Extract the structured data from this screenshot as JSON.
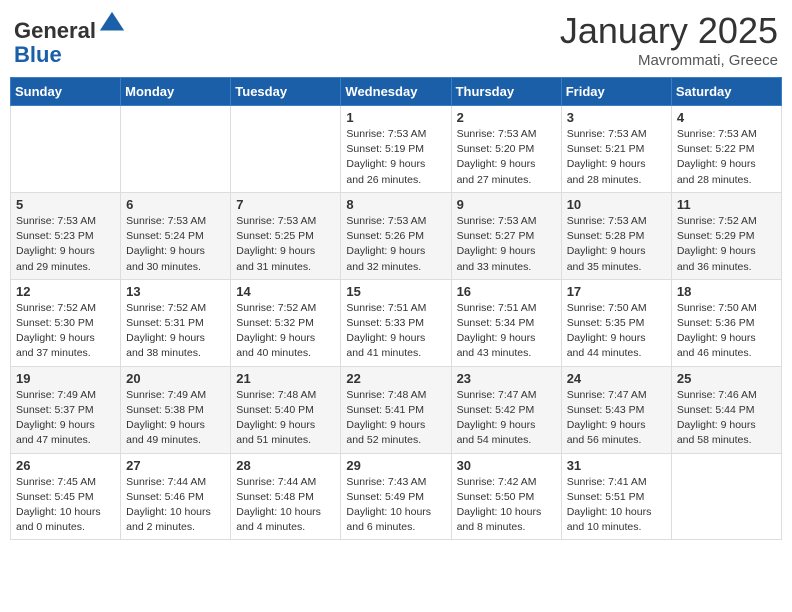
{
  "header": {
    "logo_general": "General",
    "logo_blue": "Blue",
    "month_title": "January 2025",
    "location": "Mavrommati, Greece"
  },
  "weekdays": [
    "Sunday",
    "Monday",
    "Tuesday",
    "Wednesday",
    "Thursday",
    "Friday",
    "Saturday"
  ],
  "weeks": [
    [
      {
        "day": "",
        "info": ""
      },
      {
        "day": "",
        "info": ""
      },
      {
        "day": "",
        "info": ""
      },
      {
        "day": "1",
        "info": "Sunrise: 7:53 AM\nSunset: 5:19 PM\nDaylight: 9 hours\nand 26 minutes."
      },
      {
        "day": "2",
        "info": "Sunrise: 7:53 AM\nSunset: 5:20 PM\nDaylight: 9 hours\nand 27 minutes."
      },
      {
        "day": "3",
        "info": "Sunrise: 7:53 AM\nSunset: 5:21 PM\nDaylight: 9 hours\nand 28 minutes."
      },
      {
        "day": "4",
        "info": "Sunrise: 7:53 AM\nSunset: 5:22 PM\nDaylight: 9 hours\nand 28 minutes."
      }
    ],
    [
      {
        "day": "5",
        "info": "Sunrise: 7:53 AM\nSunset: 5:23 PM\nDaylight: 9 hours\nand 29 minutes."
      },
      {
        "day": "6",
        "info": "Sunrise: 7:53 AM\nSunset: 5:24 PM\nDaylight: 9 hours\nand 30 minutes."
      },
      {
        "day": "7",
        "info": "Sunrise: 7:53 AM\nSunset: 5:25 PM\nDaylight: 9 hours\nand 31 minutes."
      },
      {
        "day": "8",
        "info": "Sunrise: 7:53 AM\nSunset: 5:26 PM\nDaylight: 9 hours\nand 32 minutes."
      },
      {
        "day": "9",
        "info": "Sunrise: 7:53 AM\nSunset: 5:27 PM\nDaylight: 9 hours\nand 33 minutes."
      },
      {
        "day": "10",
        "info": "Sunrise: 7:53 AM\nSunset: 5:28 PM\nDaylight: 9 hours\nand 35 minutes."
      },
      {
        "day": "11",
        "info": "Sunrise: 7:52 AM\nSunset: 5:29 PM\nDaylight: 9 hours\nand 36 minutes."
      }
    ],
    [
      {
        "day": "12",
        "info": "Sunrise: 7:52 AM\nSunset: 5:30 PM\nDaylight: 9 hours\nand 37 minutes."
      },
      {
        "day": "13",
        "info": "Sunrise: 7:52 AM\nSunset: 5:31 PM\nDaylight: 9 hours\nand 38 minutes."
      },
      {
        "day": "14",
        "info": "Sunrise: 7:52 AM\nSunset: 5:32 PM\nDaylight: 9 hours\nand 40 minutes."
      },
      {
        "day": "15",
        "info": "Sunrise: 7:51 AM\nSunset: 5:33 PM\nDaylight: 9 hours\nand 41 minutes."
      },
      {
        "day": "16",
        "info": "Sunrise: 7:51 AM\nSunset: 5:34 PM\nDaylight: 9 hours\nand 43 minutes."
      },
      {
        "day": "17",
        "info": "Sunrise: 7:50 AM\nSunset: 5:35 PM\nDaylight: 9 hours\nand 44 minutes."
      },
      {
        "day": "18",
        "info": "Sunrise: 7:50 AM\nSunset: 5:36 PM\nDaylight: 9 hours\nand 46 minutes."
      }
    ],
    [
      {
        "day": "19",
        "info": "Sunrise: 7:49 AM\nSunset: 5:37 PM\nDaylight: 9 hours\nand 47 minutes."
      },
      {
        "day": "20",
        "info": "Sunrise: 7:49 AM\nSunset: 5:38 PM\nDaylight: 9 hours\nand 49 minutes."
      },
      {
        "day": "21",
        "info": "Sunrise: 7:48 AM\nSunset: 5:40 PM\nDaylight: 9 hours\nand 51 minutes."
      },
      {
        "day": "22",
        "info": "Sunrise: 7:48 AM\nSunset: 5:41 PM\nDaylight: 9 hours\nand 52 minutes."
      },
      {
        "day": "23",
        "info": "Sunrise: 7:47 AM\nSunset: 5:42 PM\nDaylight: 9 hours\nand 54 minutes."
      },
      {
        "day": "24",
        "info": "Sunrise: 7:47 AM\nSunset: 5:43 PM\nDaylight: 9 hours\nand 56 minutes."
      },
      {
        "day": "25",
        "info": "Sunrise: 7:46 AM\nSunset: 5:44 PM\nDaylight: 9 hours\nand 58 minutes."
      }
    ],
    [
      {
        "day": "26",
        "info": "Sunrise: 7:45 AM\nSunset: 5:45 PM\nDaylight: 10 hours\nand 0 minutes."
      },
      {
        "day": "27",
        "info": "Sunrise: 7:44 AM\nSunset: 5:46 PM\nDaylight: 10 hours\nand 2 minutes."
      },
      {
        "day": "28",
        "info": "Sunrise: 7:44 AM\nSunset: 5:48 PM\nDaylight: 10 hours\nand 4 minutes."
      },
      {
        "day": "29",
        "info": "Sunrise: 7:43 AM\nSunset: 5:49 PM\nDaylight: 10 hours\nand 6 minutes."
      },
      {
        "day": "30",
        "info": "Sunrise: 7:42 AM\nSunset: 5:50 PM\nDaylight: 10 hours\nand 8 minutes."
      },
      {
        "day": "31",
        "info": "Sunrise: 7:41 AM\nSunset: 5:51 PM\nDaylight: 10 hours\nand 10 minutes."
      },
      {
        "day": "",
        "info": ""
      }
    ]
  ]
}
